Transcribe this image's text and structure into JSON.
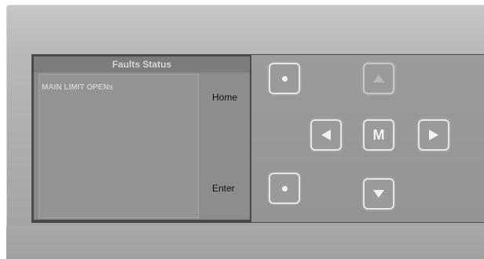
{
  "lcd": {
    "title": "Faults Status",
    "message": "MAIN LIMIT OPENs",
    "softkeys": {
      "top": "Home",
      "bottom": "Enter"
    }
  },
  "keys": {
    "menu_label": "M"
  },
  "icons": {
    "up": "triangle-up-icon",
    "down": "triangle-down-icon",
    "left": "triangle-left-icon",
    "right": "triangle-right-icon",
    "softkey": "dot-icon"
  }
}
